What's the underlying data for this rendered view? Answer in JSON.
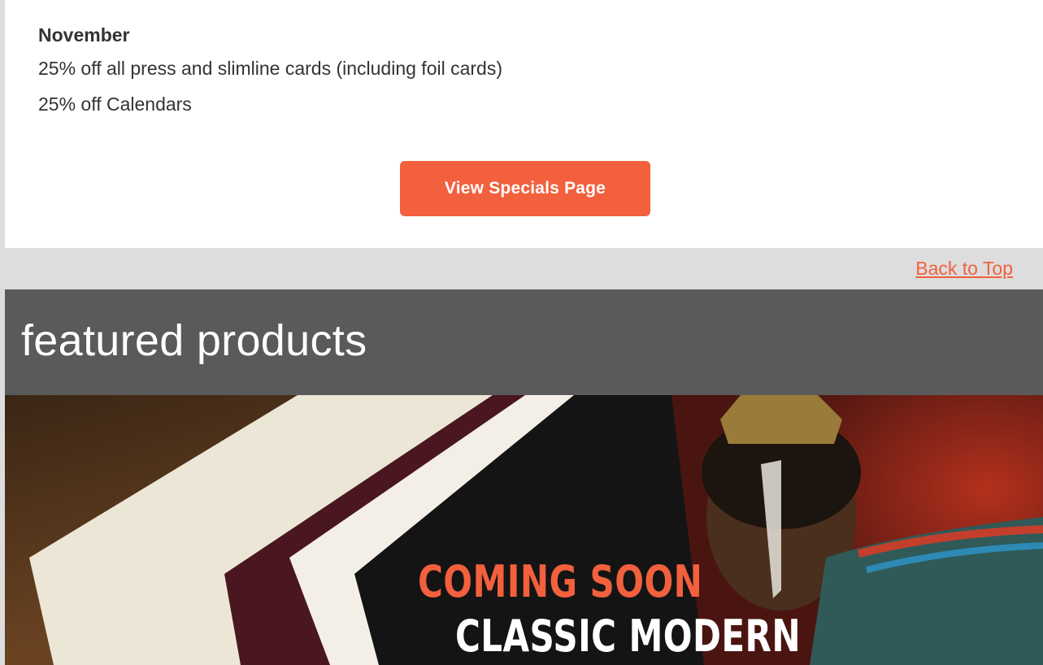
{
  "specials": {
    "month": "November",
    "offers": [
      "25% off all press and slimline cards (including foil cards)",
      "25% off Calendars"
    ],
    "button_label": "View Specials Page"
  },
  "nav": {
    "back_to_top": "Back to Top"
  },
  "featured": {
    "title": "featured products",
    "banner": {
      "headline": "COMING SOON",
      "subheadline": "CLASSIC MODERN"
    }
  },
  "colors": {
    "accent": "#f2603d",
    "header_bg": "#5a5a5a",
    "page_bg": "#dddddd"
  }
}
